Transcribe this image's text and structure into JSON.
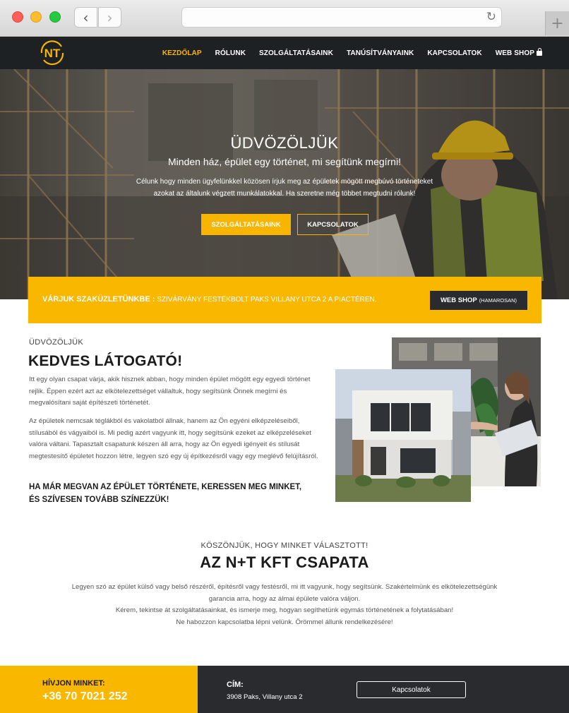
{
  "browser": {
    "back_icon": "‹",
    "forward_icon": "›",
    "reload_icon": "↻",
    "new_tab_icon": "+"
  },
  "header": {
    "logo_text": "NT",
    "nav": [
      {
        "label": "KEZDŐLAP",
        "active": true
      },
      {
        "label": "RÓLUNK"
      },
      {
        "label": "SZOLGÁLTATÁSAINK"
      },
      {
        "label": "TANÚSÍTVÁNYAINK"
      },
      {
        "label": "KAPCSOLATOK"
      },
      {
        "label": "WEB SHOP",
        "icon": "shopping-bag-icon"
      }
    ]
  },
  "hero": {
    "title": "ÜDVÖZÖLJÜK",
    "subtitle": "Minden ház, épület egy történet, mi segítünk megírni!",
    "text_line1": "Célunk hogy minden ügyfelünkkel közösen írjuk meg az épületek mögött megbúvó történeteket",
    "text_line2": "azokat az általunk végzett munkálatokkal. Ha szeretne még többet megtudni rólunk!",
    "button_primary": "SZOLGÁLTATÁSAINK",
    "button_secondary": "KAPCSOLATOK"
  },
  "banner": {
    "label": "VÁRJUK SZAKÜZLETÜNKBE :",
    "text": "SZIVÁRVÁNY FESTÉKBOLT PAKS VILLANY UTCA 2 A PIACTÉREN.",
    "button_label": "WEB SHOP",
    "button_note": "(HAMAROSAN)"
  },
  "welcome": {
    "eyebrow": "ÜDVÖZÖLJÜK",
    "title": "KEDVES LÁTOGATÓ!",
    "p1": "Itt egy olyan csapat várja, akik hisznek abban, hogy minden épület mögött egy egyedi történet rejlik. Éppen ezért azt az elkötelezettséget vállaltuk, hogy segítsünk Önnek megírni és megvalósítani saját építészeti történetét.",
    "p2": "Az épületek nemcsak téglákból és vakolatból állnak, hanem az Ön egyéni elképzeléseiből, stílusából és vágyaiból is. Mi pedig azért vagyunk itt, hogy segítsünk ezeket az elképzeléseket valóra váltani. Tapasztalt csapatunk készen áll arra, hogy az Ön egyedi igényeit és stílusát megtestesítő épületet hozzon létre, legyen szó egy új építkezésről vagy egy meglévő felújításról.",
    "cta": "HA MÁR MEGVAN AZ ÉPÜLET TÖRTÉNETE, KERESSEN MEG MINKET, ÉS SZÍVESEN TOVÁBB SZÍNEZZÜK!"
  },
  "team": {
    "eyebrow": "KÖSZÖNJÜK, HOGY MINKET VÁLASZTOTT!",
    "title": "AZ N+T KFT CSAPATA",
    "line1": "Legyen szó az épület külső vagy belső részéről, építésről vagy festésről, mi itt vagyunk, hogy segítsünk. Szakértelmünk és elkötelezettségünk",
    "line2": "garancia arra, hogy az álmai épülete valóra váljon.",
    "line3": "Kérem, tekintse át szolgáltatásainkat, és ismerje meg, hogyan segíthetünk egymás történetének a folytatásában!",
    "line4": "Ne habozzon kapcsolatba lépni velünk. Örömmel állunk rendelkezésére!"
  },
  "footer": {
    "call_label": "HÍVJON MINKET:",
    "phone": "+36 70 7021 252",
    "address_label": "CÍM:",
    "address": "3908 Paks, Villany utca 2",
    "contact_button": "Kapcsolatok"
  },
  "colors": {
    "accent": "#f7b500",
    "dark": "#1e2124",
    "footer_dark": "#2a2b2e"
  }
}
